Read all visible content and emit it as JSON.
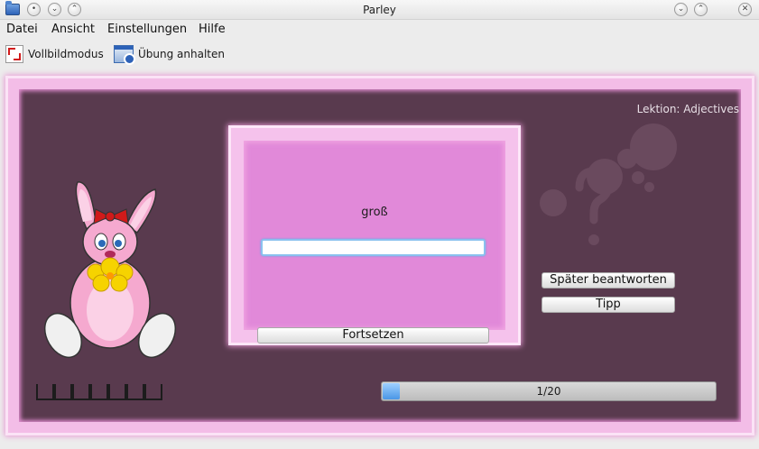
{
  "window": {
    "title": "Parley"
  },
  "menu": {
    "file": "Datei",
    "view": "Ansicht",
    "settings": "Einstellungen",
    "help": "Hilfe"
  },
  "toolbar": {
    "fullscreen_label": "Vollbildmodus",
    "pause_label": "Übung anhalten",
    "fullscreen_icon": "fullscreen-icon",
    "pause_icon": "pause-practice-icon"
  },
  "practice": {
    "lesson": "Lektion: Adjectives",
    "question": "groß",
    "answer_value": "",
    "continue_label": "Fortsetzen",
    "answer_later_label": "Später beantworten",
    "hint_label": "Tipp",
    "score_boxes": 7,
    "progress": {
      "text": "1/20",
      "fraction": 0.05
    }
  },
  "colors": {
    "stage_bg": "#593a4e",
    "fur_border": "#f3bde7",
    "card_bg": "#e189d9",
    "progress_fill": "#4a96e6"
  }
}
